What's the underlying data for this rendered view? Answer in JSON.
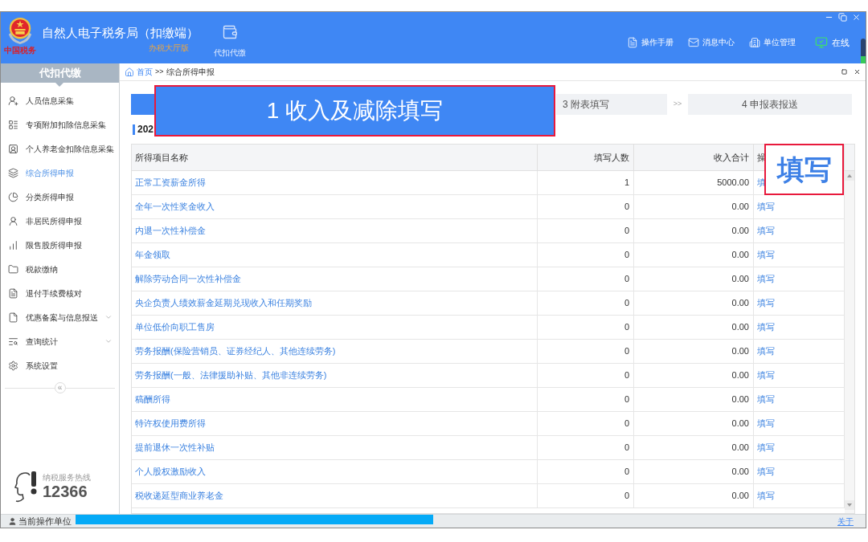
{
  "window": {
    "title": "自然人电子税务局（扣缴端）",
    "subtitle": "办税大厅版",
    "logo_text": "中国税务",
    "nav_button": "代扣代缴"
  },
  "toolbar": [
    {
      "label": "操作手册",
      "kind": "link"
    },
    {
      "label": "消息中心",
      "kind": "link"
    },
    {
      "label": "单位管理",
      "kind": "link"
    },
    {
      "label": "在线",
      "kind": "status"
    }
  ],
  "sidebar": {
    "title": "代扣代缴",
    "items": [
      {
        "label": "人员信息采集",
        "selected": false,
        "kind": "item"
      },
      {
        "label": "专项附加扣除信息采集",
        "selected": false,
        "kind": "item"
      },
      {
        "label": "个人养老金扣除信息采集",
        "selected": false,
        "kind": "item"
      },
      {
        "label": "综合所得申报",
        "selected": true,
        "kind": "item"
      },
      {
        "label": "分类所得申报",
        "selected": false,
        "kind": "item"
      },
      {
        "label": "非居民所得申报",
        "selected": false,
        "kind": "item"
      },
      {
        "label": "限售股所得申报",
        "selected": false,
        "kind": "item"
      },
      {
        "label": "税款缴纳",
        "selected": false,
        "kind": "item"
      },
      {
        "label": "退付手续费核对",
        "selected": false,
        "kind": "item"
      },
      {
        "label": "优惠备案与信息报送",
        "selected": false,
        "kind": "group"
      },
      {
        "label": "查询统计",
        "selected": false,
        "kind": "group"
      },
      {
        "label": "系统设置",
        "selected": false,
        "kind": "item"
      }
    ],
    "collapse": "«",
    "hotline": {
      "caption": "纳税服务热线",
      "number": "12366"
    }
  },
  "breadcrumb": {
    "home": "首页",
    "separator": ">>",
    "current": "综合所得申报"
  },
  "steps": [
    {
      "kind": "step",
      "selected": true
    },
    {
      "kind": "step",
      "label": "3 附表填写",
      "selected": false
    },
    {
      "kind": "arrow",
      "label": ">>"
    },
    {
      "kind": "step",
      "label": "4 申报表报送",
      "selected": false
    }
  ],
  "section_title": "202",
  "table": {
    "columns": [
      "所得项目名称",
      "填写人数",
      "收入合计",
      "操"
    ],
    "rows": [
      {
        "name": "正常工资薪金所得",
        "count": "1",
        "income": "5000.00",
        "action": "填"
      },
      {
        "name": "全年一次性奖金收入",
        "count": "0",
        "income": "0.00",
        "action": "填写"
      },
      {
        "name": "内退一次性补偿金",
        "count": "0",
        "income": "0.00",
        "action": "填写"
      },
      {
        "name": "年金领取",
        "count": "0",
        "income": "0.00",
        "action": "填写"
      },
      {
        "name": "解除劳动合同一次性补偿金",
        "count": "0",
        "income": "0.00",
        "action": "填写"
      },
      {
        "name": "央企负责人绩效薪金延期兑现收入和任期奖励",
        "count": "0",
        "income": "0.00",
        "action": "填写"
      },
      {
        "name": "单位低价向职工售房",
        "count": "0",
        "income": "0.00",
        "action": "填写"
      },
      {
        "name": "劳务报酬(保险营销员、证券经纪人、其他连续劳务)",
        "count": "0",
        "income": "0.00",
        "action": "填写"
      },
      {
        "name": "劳务报酬(一般、法律援助补贴、其他非连续劳务)",
        "count": "0",
        "income": "0.00",
        "action": "填写"
      },
      {
        "name": "稿酬所得",
        "count": "0",
        "income": "0.00",
        "action": "填写"
      },
      {
        "name": "特许权使用费所得",
        "count": "0",
        "income": "0.00",
        "action": "填写"
      },
      {
        "name": "提前退休一次性补贴",
        "count": "0",
        "income": "0.00",
        "action": "填写"
      },
      {
        "name": "个人股权激励收入",
        "count": "0",
        "income": "0.00",
        "action": "填写"
      },
      {
        "name": "税收递延型商业养老金",
        "count": "0",
        "income": "0.00",
        "action": "填写"
      }
    ]
  },
  "callouts": [
    {
      "text": "1 收入及减除填写"
    },
    {
      "text": "填写"
    }
  ],
  "status_bar": {
    "label": "当前操作单位",
    "about": "关于"
  }
}
